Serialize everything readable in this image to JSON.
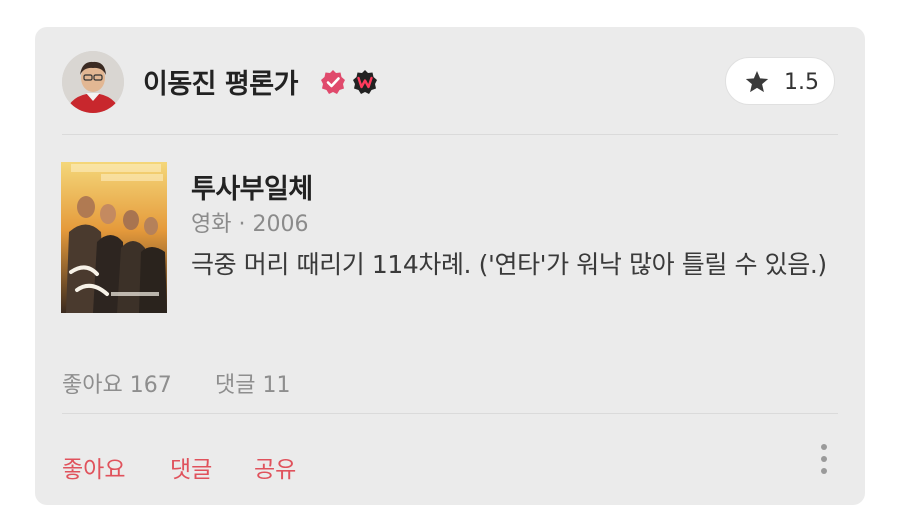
{
  "critic": {
    "name": "이동진 평론가",
    "rating": "1.5"
  },
  "movie": {
    "title": "투사부일체",
    "meta": "영화 · 2006",
    "review": "극중 머리 때리기 114차례. ('연타'가 워낙 많아 틀릴 수 있음.)"
  },
  "stats": {
    "likes": "좋아요 167",
    "comments": "댓글 11"
  },
  "actions": {
    "like": "좋아요",
    "comment": "댓글",
    "share": "공유"
  },
  "colors": {
    "accent": "#e0525c",
    "verified": "#e04a6c",
    "card_bg": "#ebebeb"
  },
  "icons": {
    "verified": "verified-badge-icon",
    "watcha": "watcha-w-icon",
    "star": "star-icon",
    "more": "more-vertical-icon"
  }
}
